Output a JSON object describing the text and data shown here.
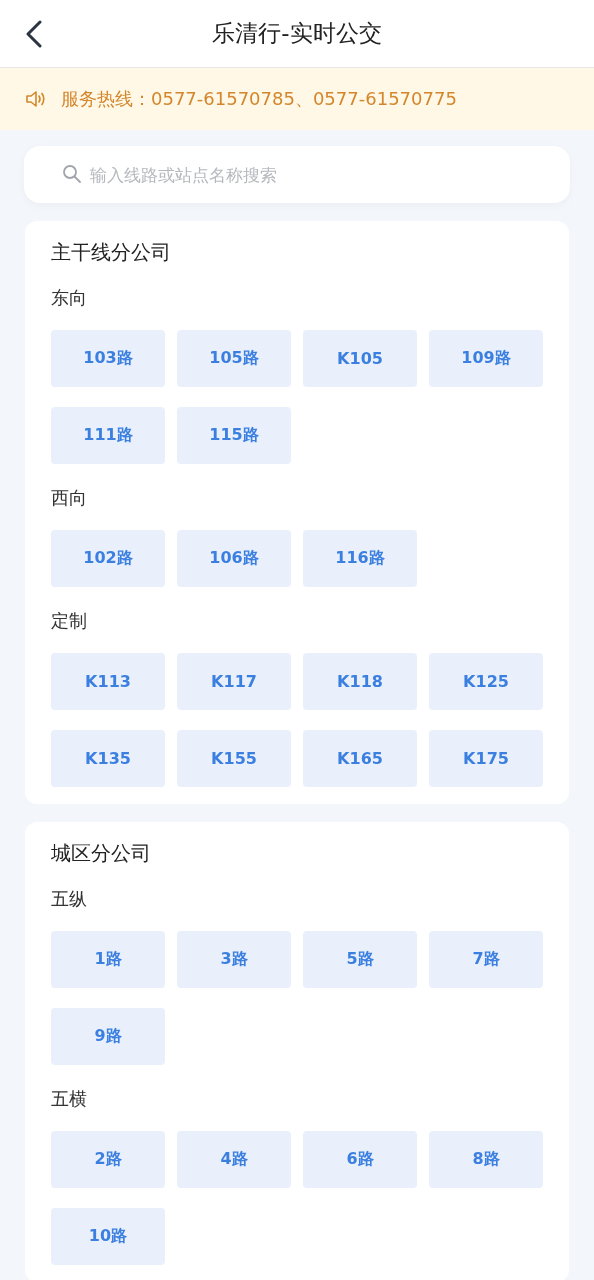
{
  "header": {
    "title": "乐清行-实时公交"
  },
  "notice": {
    "text": "服务热线：0577-61570785、0577-61570775"
  },
  "search": {
    "placeholder": "输入线路或站点名称搜索"
  },
  "companies": [
    {
      "name": "主干线分公司",
      "groups": [
        {
          "name": "东向",
          "routes": [
            "103路",
            "105路",
            "K105",
            "109路",
            "111路",
            "115路"
          ]
        },
        {
          "name": "西向",
          "routes": [
            "102路",
            "106路",
            "116路"
          ]
        },
        {
          "name": "定制",
          "routes": [
            "K113",
            "K117",
            "K118",
            "K125",
            "K135",
            "K155",
            "K165",
            "K175"
          ]
        }
      ]
    },
    {
      "name": "城区分公司",
      "groups": [
        {
          "name": "五纵",
          "routes": [
            "1路",
            "3路",
            "5路",
            "7路",
            "9路"
          ]
        },
        {
          "name": "五横",
          "routes": [
            "2路",
            "4路",
            "6路",
            "8路",
            "10路"
          ]
        }
      ]
    }
  ]
}
